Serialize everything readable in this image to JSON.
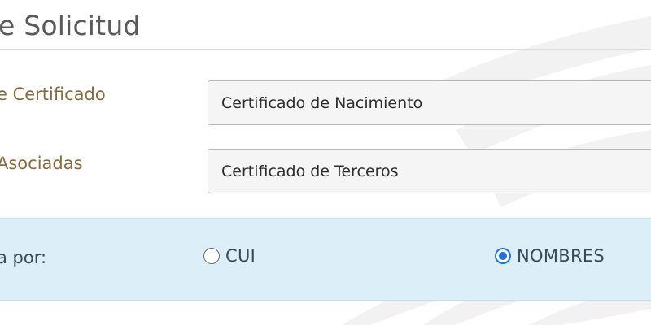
{
  "section": {
    "title": "e Solicitud"
  },
  "fields": {
    "certificate_type": {
      "label": "e Certificado",
      "value": "Certificado de Nacimiento"
    },
    "associated": {
      "label": "Asociadas",
      "value": "Certificado de Terceros"
    }
  },
  "search": {
    "label": "a por:",
    "options": [
      {
        "label": "CUI",
        "selected": false
      },
      {
        "label": "NOMBRES",
        "selected": true
      }
    ]
  },
  "colors": {
    "label_brown": "#8a6a3a",
    "panel_blue": "#dceef8",
    "radio_accent": "#1f72e6"
  }
}
